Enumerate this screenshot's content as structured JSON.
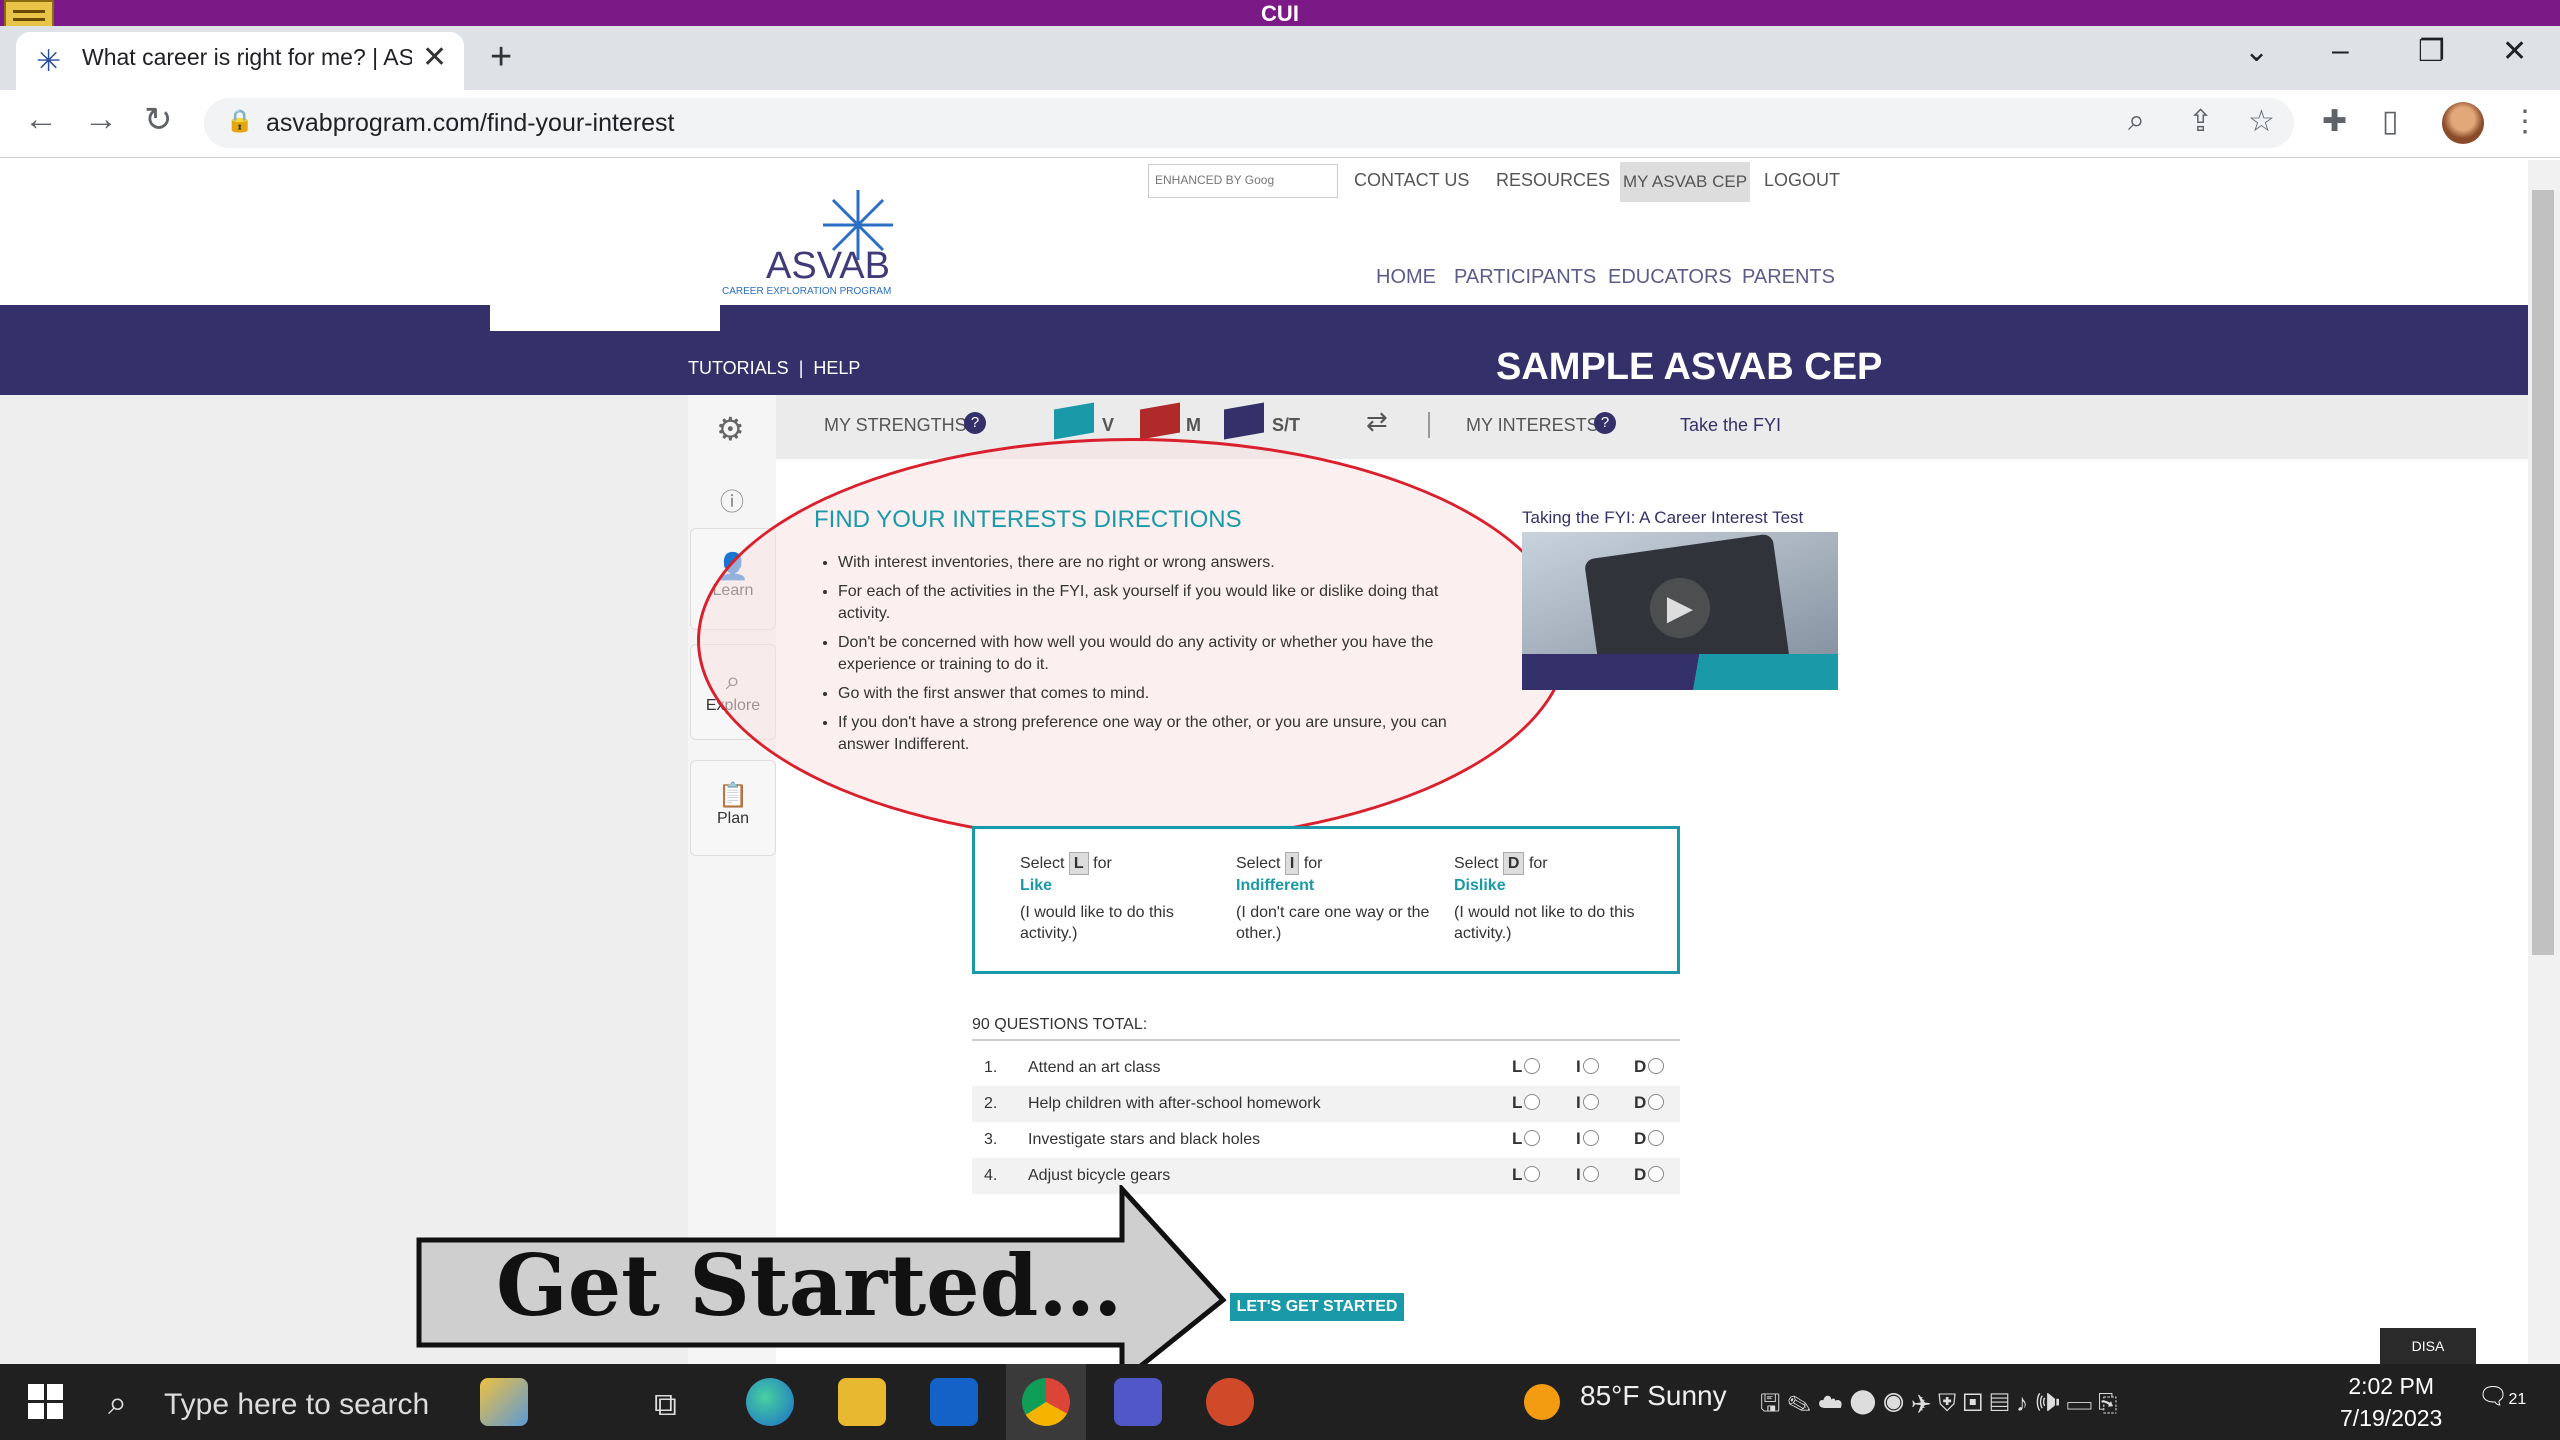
{
  "cui_banner": "CUI",
  "browser": {
    "tab_title": "What career is right for me? | AS",
    "url": "asvabprogram.com/find-your-interest",
    "new_tab": "+",
    "tab_close": "✕"
  },
  "site": {
    "top_links": {
      "search_label": "ENHANCED BY Goog",
      "contact": "CONTACT US",
      "resources": "RESOURCES",
      "my_cep": "MY ASVAB CEP",
      "logout": "LOGOUT"
    },
    "logo_text": "ASVAB",
    "logo_sub": "CAREER EXPLORATION PROGRAM",
    "main_nav": [
      "HOME",
      "PARTICIPANTS",
      "EDUCATORS",
      "PARENTS"
    ],
    "title": "SAMPLE ASVAB CEP",
    "sub_links": {
      "tutorials": "TUTORIALS",
      "help": "HELP"
    },
    "sidebar": [
      "Learn",
      "Explore",
      "Plan"
    ],
    "strengths": {
      "label": "MY STRENGTHS",
      "v": "V",
      "m": "M",
      "st": "S/T",
      "interests": "MY INTERESTS",
      "take_fyi": "Take the FYI"
    }
  },
  "directions": {
    "title": "FIND YOUR INTERESTS DIRECTIONS",
    "items": [
      "With interest inventories, there are no right or wrong answers.",
      "For each of the activities in the FYI, ask yourself if you would like or dislike doing that activity.",
      "Don't be concerned with how well you would do any activity or whether you have the experience or training to do it.",
      "Go with the first answer that comes to mind.",
      "If you don't have a strong preference one way or the other, or you are unsure, you can answer Indifferent."
    ],
    "video_title": "Taking the FYI: A Career Interest Test"
  },
  "legend": [
    {
      "select": "Select",
      "key": "L",
      "for": "for",
      "word": "Like",
      "desc": "(I would like to do this activity.)"
    },
    {
      "select": "Select",
      "key": "I",
      "for": "for",
      "word": "Indifferent",
      "desc": "(I don't care one way or the other.)"
    },
    {
      "select": "Select",
      "key": "D",
      "for": "for",
      "word": "Dislike",
      "desc": "(I would not like to do this activity.)"
    }
  ],
  "questions": {
    "total_label": "90 QUESTIONS TOTAL:",
    "options": [
      "L",
      "I",
      "D"
    ],
    "rows": [
      {
        "num": "1.",
        "text": "Attend an art class"
      },
      {
        "num": "2.",
        "text": "Help children with after-school homework"
      },
      {
        "num": "3.",
        "text": "Investigate stars and black holes"
      },
      {
        "num": "4.",
        "text": "Adjust bicycle gears"
      }
    ]
  },
  "overlay_text": "Get Started…",
  "start_button": "LET'S GET STARTED",
  "disa_badge": "DISA",
  "taskbar": {
    "search_placeholder": "Type here to search",
    "weather": "85°F  Sunny",
    "time": "2:02 PM",
    "date": "7/19/2023",
    "notifications": "21"
  },
  "colors": {
    "navy": "#34306a",
    "teal": "#1a9aa8",
    "cui_purple": "#7b1a87",
    "annotation_red": "#d9202c"
  }
}
